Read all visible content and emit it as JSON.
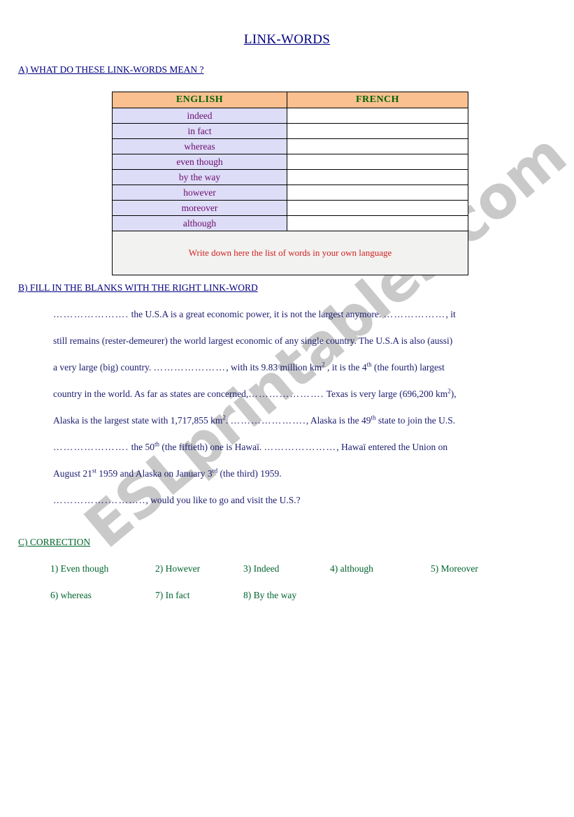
{
  "document": {
    "title": "LINK-WORDS"
  },
  "sections": {
    "a": {
      "heading": "A)  WHAT DO THESE LINK-WORDS MEAN ?",
      "table": {
        "headers": [
          "ENGLISH",
          "FRENCH"
        ],
        "rows": [
          {
            "english": "indeed",
            "french": ""
          },
          {
            "english": "in fact",
            "french": ""
          },
          {
            "english": "whereas",
            "french": ""
          },
          {
            "english": "even though",
            "french": ""
          },
          {
            "english": "by the way",
            "french": ""
          },
          {
            "english": "however",
            "french": ""
          },
          {
            "english": "moreover",
            "french": ""
          },
          {
            "english": "although",
            "french": ""
          }
        ],
        "footer_note": "Write down here the list of words in your own language"
      }
    },
    "b": {
      "heading": "B) FILL IN THE BLANKS WITH THE RIGHT LINK-WORD",
      "lines": [
        {
          "parts": [
            {
              "type": "blank",
              "text": "…………………."
            },
            {
              "type": "text",
              "text": " the U.S.A  is a great economic power, it is not the largest anymore.   "
            },
            {
              "type": "blank",
              "text": "………………"
            },
            {
              "type": "text",
              "text": ", it"
            }
          ]
        },
        {
          "parts": [
            {
              "type": "text",
              "text": "still remains (rester-demeurer)  the world largest economic of any single country. The U.S.A  is also (aussi)"
            }
          ]
        },
        {
          "parts": [
            {
              "type": "text",
              "text": "a very large (big) country.  "
            },
            {
              "type": "blank",
              "text": "…………………"
            },
            {
              "type": "text",
              "text": ", with its 9.83 million km"
            },
            {
              "type": "sup",
              "text": "2"
            },
            {
              "type": "text",
              "text": " , it is the 4"
            },
            {
              "type": "sup",
              "text": "th"
            },
            {
              "type": "text",
              "text": " (the fourth) largest"
            }
          ]
        },
        {
          "parts": [
            {
              "type": "text",
              "text": "country in the world. As far as states are concerned,"
            },
            {
              "type": "blank",
              "text": "…………………."
            },
            {
              "type": "text",
              "text": " Texas is very large (696,200 km"
            },
            {
              "type": "sup",
              "text": "2"
            },
            {
              "type": "text",
              "text": "),"
            }
          ]
        },
        {
          "parts": [
            {
              "type": "text",
              "text": "Alaska is the largest state with  1,717,855 km"
            },
            {
              "type": "sup",
              "text": "2"
            },
            {
              "type": "text",
              "text": ".  "
            },
            {
              "type": "blank",
              "text": "…………………."
            },
            {
              "type": "text",
              "text": ", Alaska is the 49"
            },
            {
              "type": "sup",
              "text": "th"
            },
            {
              "type": "text",
              "text": " state to join the U.S."
            }
          ]
        },
        {
          "parts": [
            {
              "type": "blank",
              "text": "…………………."
            },
            {
              "type": "text",
              "text": " the 50"
            },
            {
              "type": "sup",
              "text": "th"
            },
            {
              "type": "text",
              "text": " (the fiftieth) one is Hawaï.  "
            },
            {
              "type": "blank",
              "text": "…………………"
            },
            {
              "type": "text",
              "text": ", Hawaï  entered the Union on"
            }
          ]
        },
        {
          "parts": [
            {
              "type": "text",
              "text": "August 21"
            },
            {
              "type": "sup",
              "text": "st"
            },
            {
              "type": "text",
              "text": " 1959 and Alaska on January 3"
            },
            {
              "type": "sup",
              "text": "rd"
            },
            {
              "type": "text",
              "text": " (the third) 1959."
            }
          ]
        },
        {
          "parts": [
            {
              "type": "blank",
              "text": "…………….……….."
            },
            {
              "type": "text",
              "text": ", would you like to go and visit the U.S.?"
            }
          ]
        }
      ]
    },
    "c": {
      "heading": "C) CORRECTION",
      "answers_row1": [
        "1)  Even though",
        "2) However",
        "3) Indeed",
        "4) although",
        "5) Moreover"
      ],
      "answers_row2": [
        "6)  whereas",
        "7) In fact",
        "8) By the way"
      ]
    }
  },
  "watermark": {
    "text": "ESLprintables.com"
  },
  "colors": {
    "title": "#000080",
    "heading_blue": "#000080",
    "heading_green": "#00642d",
    "table_header_bg": "#fac090",
    "table_header_text": "#006400",
    "english_cell_bg": "#ddddf8",
    "english_cell_text": "#6b0b6b",
    "footer_bg": "#f2f2f0",
    "footer_text": "#d02020",
    "body_text": "#1a1a6e",
    "watermark": "#c9c9c9"
  }
}
